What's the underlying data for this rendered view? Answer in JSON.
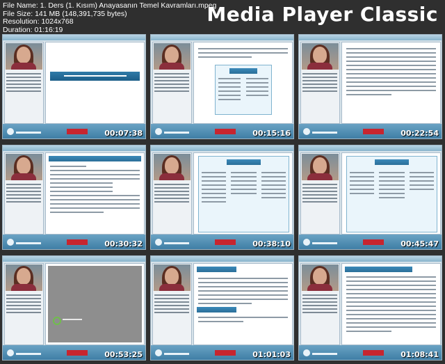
{
  "file_info": {
    "name": "File Name: 1. Ders (1. Kısım)  Anayasanın Temel Kavramları.mpeg",
    "size": "File Size: 141 MB (148,391,735 bytes)",
    "resolution": "Resolution: 1024x768",
    "duration": "Duration: 01:16:19"
  },
  "brand": "Media Player Classic",
  "thumbnails": [
    {
      "timestamp": "00:07:38"
    },
    {
      "timestamp": "00:15:16"
    },
    {
      "timestamp": "00:22:54"
    },
    {
      "timestamp": "00:30:32"
    },
    {
      "timestamp": "00:38:10"
    },
    {
      "timestamp": "00:45:47"
    },
    {
      "timestamp": "00:53:25"
    },
    {
      "timestamp": "01:01:03"
    },
    {
      "timestamp": "01:08:41"
    }
  ]
}
